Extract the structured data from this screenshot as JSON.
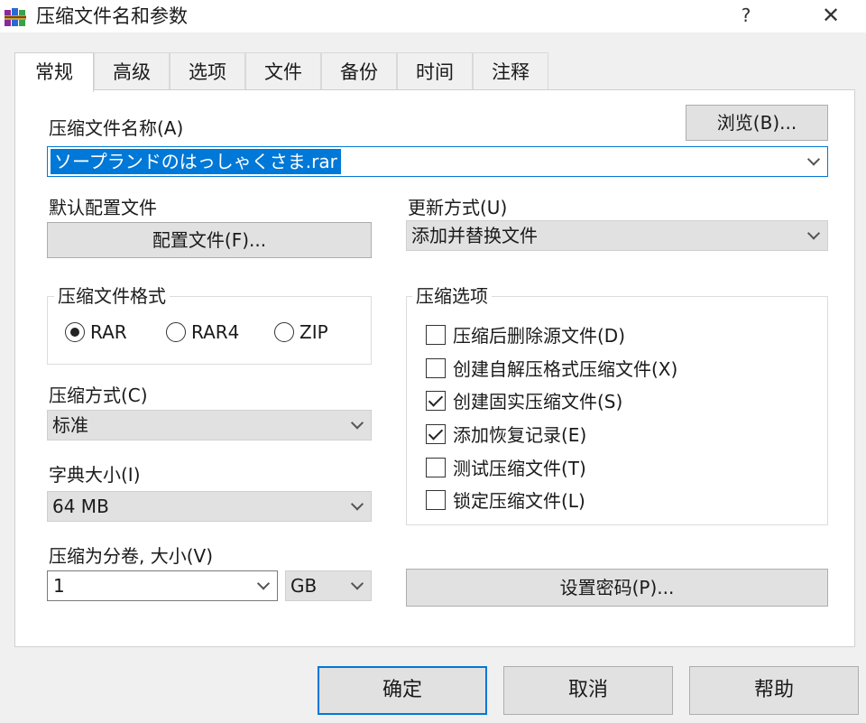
{
  "window": {
    "title": "压缩文件名和参数",
    "help": "?",
    "close": "✕"
  },
  "tabs": [
    "常规",
    "高级",
    "选项",
    "文件",
    "备份",
    "时间",
    "注释"
  ],
  "general": {
    "archive_name_label": "压缩文件名称(A)",
    "browse_button": "浏览(B)...",
    "archive_name_value": "ソープランドのはっしゃくさま.rar",
    "profile_label": "默认配置文件",
    "profile_button": "配置文件(F)...",
    "update_mode_label": "更新方式(U)",
    "update_mode_value": "添加并替换文件",
    "format_group": {
      "title": "压缩文件格式",
      "options": [
        "RAR",
        "RAR4",
        "ZIP"
      ],
      "selected": "RAR"
    },
    "method_label": "压缩方式(C)",
    "method_value": "标准",
    "dict_label": "字典大小(I)",
    "dict_value": "64 MB",
    "split_label": "压缩为分卷, 大小(V)",
    "split_value": "1",
    "split_unit": "GB",
    "options_group": {
      "title": "压缩选项",
      "items": [
        {
          "label": "压缩后删除源文件(D)",
          "checked": false
        },
        {
          "label": "创建自解压格式压缩文件(X)",
          "checked": false
        },
        {
          "label": "创建固实压缩文件(S)",
          "checked": true
        },
        {
          "label": "添加恢复记录(E)",
          "checked": true
        },
        {
          "label": "测试压缩文件(T)",
          "checked": false
        },
        {
          "label": "锁定压缩文件(L)",
          "checked": false
        }
      ]
    },
    "password_button": "设置密码(P)..."
  },
  "footer": {
    "ok": "确定",
    "cancel": "取消",
    "help": "帮助"
  },
  "colors": {
    "accent": "#0078d7",
    "selection": "#0078d7"
  },
  "icons": {
    "app": "winrar-books-icon"
  }
}
